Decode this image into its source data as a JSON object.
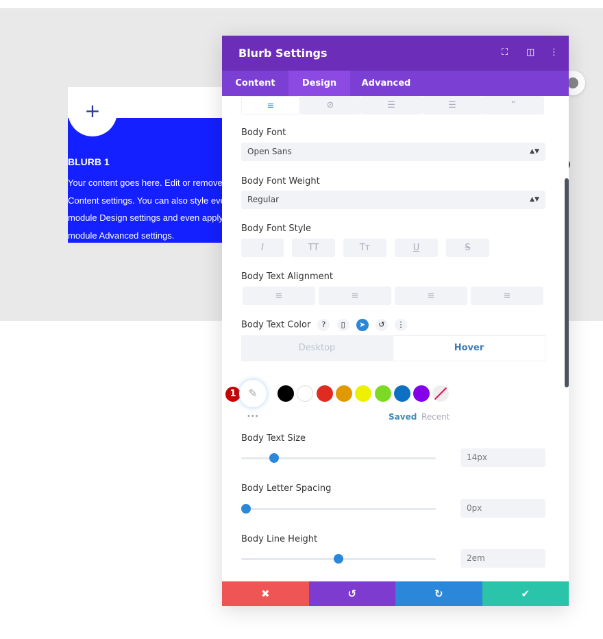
{
  "preview": {
    "blurb_title": "BLURB 1",
    "blurb_lines": [
      "Your content goes here. Edit or remove this text inline or in the module",
      "Content settings. You can also style every aspect of this content in the",
      "module Design settings and even apply custom CSS to this text in the",
      "module Advanced settings."
    ],
    "add_icon": "+"
  },
  "panel": {
    "title": "Blurb Settings",
    "header_icons": [
      "focus-icon",
      "split-view-icon",
      "more-vertical-icon"
    ],
    "tabs": [
      {
        "label": "Content"
      },
      {
        "label": "Design"
      },
      {
        "label": "Advanced"
      }
    ],
    "active_tab": "Design",
    "subtabs_icons": [
      "align-text-icon",
      "link-icon",
      "list-icon",
      "ordered-list-icon",
      "quote-icon"
    ],
    "body_font": {
      "label": "Body Font",
      "value": "Open Sans"
    },
    "body_font_weight": {
      "label": "Body Font Weight",
      "value": "Regular"
    },
    "body_font_style": {
      "label": "Body Font Style",
      "buttons": [
        "I",
        "TT",
        "Tт",
        "U",
        "S"
      ]
    },
    "body_text_alignment": {
      "label": "Body Text Alignment",
      "buttons": [
        "≡",
        "≡",
        "≡",
        "≡"
      ]
    },
    "body_text_color": {
      "label": "Body Text Color",
      "icons": {
        "help": "?",
        "device": "▯",
        "hover": "➤",
        "reset": "↺",
        "more": "⋮"
      },
      "modes": [
        "Desktop",
        "Hover"
      ],
      "active_mode": "Hover",
      "badge": "1",
      "swatches": [
        "#000000",
        "#ffffff",
        "#e02b20",
        "#e09900",
        "#edf000",
        "#7cda24",
        "#0c71c3",
        "#8300e9"
      ],
      "dots": "•••",
      "saved": "Saved",
      "recent": "Recent"
    },
    "body_text_size": {
      "label": "Body Text Size",
      "value": "14px",
      "fraction": 0.15
    },
    "body_letter_spacing": {
      "label": "Body Letter Spacing",
      "value": "0px",
      "fraction": 0.0
    },
    "body_line_height": {
      "label": "Body Line Height",
      "value": "2em",
      "fraction": 0.5
    },
    "footer": {
      "cancel": "✖",
      "undo": "↺",
      "redo": "↻",
      "save": "✔"
    },
    "colors": {
      "header": "#6c2eb9",
      "tabs": "#7b3fd4",
      "cancel": "#ef5555",
      "undo": "#7e3bd0",
      "redo": "#2b87da",
      "save": "#29c4a9",
      "accent": "#2b87da"
    }
  }
}
